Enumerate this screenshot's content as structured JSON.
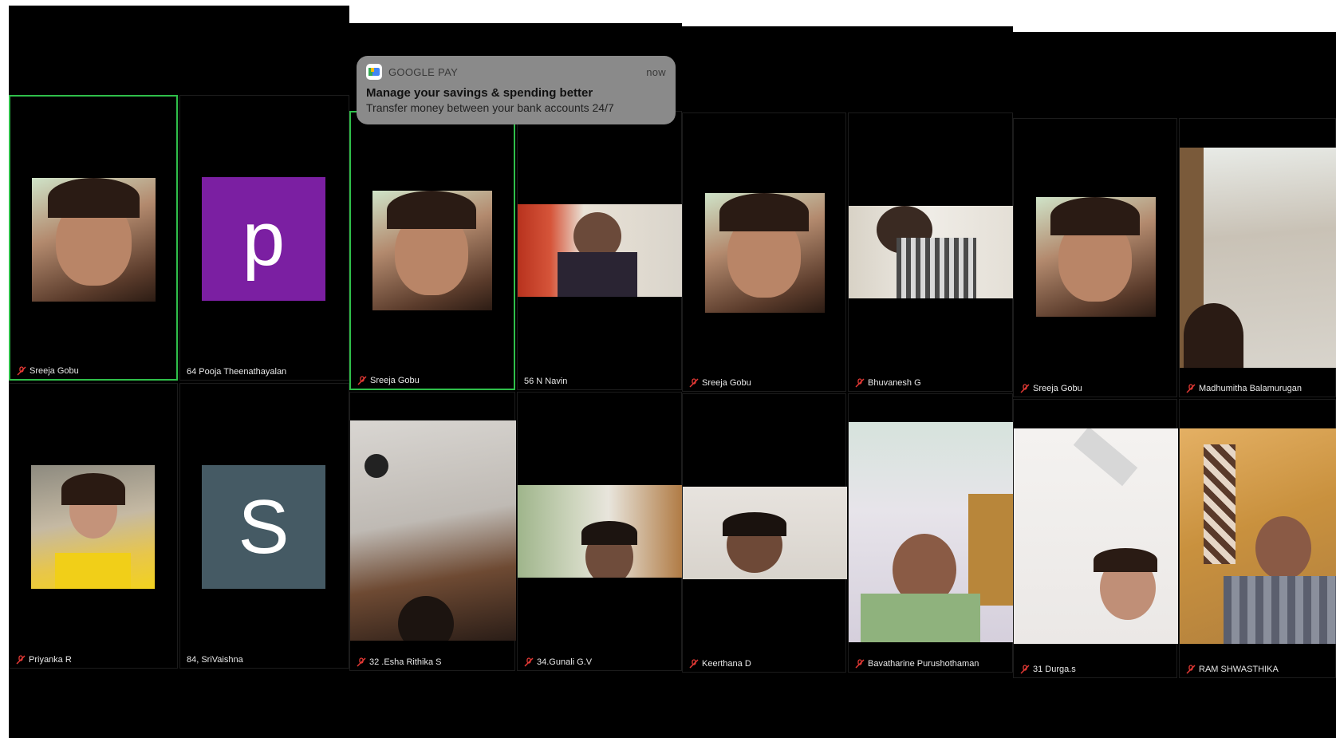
{
  "notification": {
    "app_name": "GOOGLE PAY",
    "time": "now",
    "title": "Manage your savings & spending better",
    "body": "Transfer money between your bank accounts 24/7",
    "icon": "google-pay-icon"
  },
  "panels": [
    {
      "tiles": [
        {
          "name": "Sreeja Gobu",
          "muted": true,
          "active": true,
          "type": "video"
        },
        {
          "name": "64 Pooja Theenathayalan",
          "muted": false,
          "active": false,
          "type": "avatar",
          "letter": "p",
          "avatar_color": "#7b1fa2"
        },
        {
          "name": "Priyanka R",
          "muted": true,
          "active": false,
          "type": "video"
        },
        {
          "name": "84, SriVaishna",
          "muted": false,
          "active": false,
          "type": "avatar",
          "letter": "S",
          "avatar_color": "#455a64"
        }
      ]
    },
    {
      "tiles": [
        {
          "name": "Sreeja Gobu",
          "muted": true,
          "active": true,
          "type": "video"
        },
        {
          "name": "56 N Navin",
          "muted": false,
          "active": false,
          "type": "video"
        },
        {
          "name": "32 .Esha Rithika S",
          "muted": true,
          "active": false,
          "type": "video"
        },
        {
          "name": "34.Gunali G.V",
          "muted": true,
          "active": false,
          "type": "video"
        }
      ]
    },
    {
      "tiles": [
        {
          "name": "Sreeja Gobu",
          "muted": true,
          "active": false,
          "type": "video"
        },
        {
          "name": "Bhuvanesh G",
          "muted": true,
          "active": false,
          "type": "video"
        },
        {
          "name": "Keerthana D",
          "muted": true,
          "active": false,
          "type": "video"
        },
        {
          "name": "Bavatharine Purushothaman",
          "muted": true,
          "active": false,
          "type": "video"
        }
      ]
    },
    {
      "tiles": [
        {
          "name": "Sreeja Gobu",
          "muted": true,
          "active": false,
          "type": "video"
        },
        {
          "name": "Madhumitha Balamurugan",
          "muted": true,
          "active": false,
          "type": "video"
        },
        {
          "name": "31 Durga.s",
          "muted": true,
          "active": false,
          "type": "video"
        },
        {
          "name": "RAM SHWASTHIKA",
          "muted": true,
          "active": false,
          "type": "video"
        }
      ]
    }
  ],
  "colors": {
    "active_border": "#2fbf4a",
    "mute_icon": "#e53935",
    "background": "#000000"
  }
}
